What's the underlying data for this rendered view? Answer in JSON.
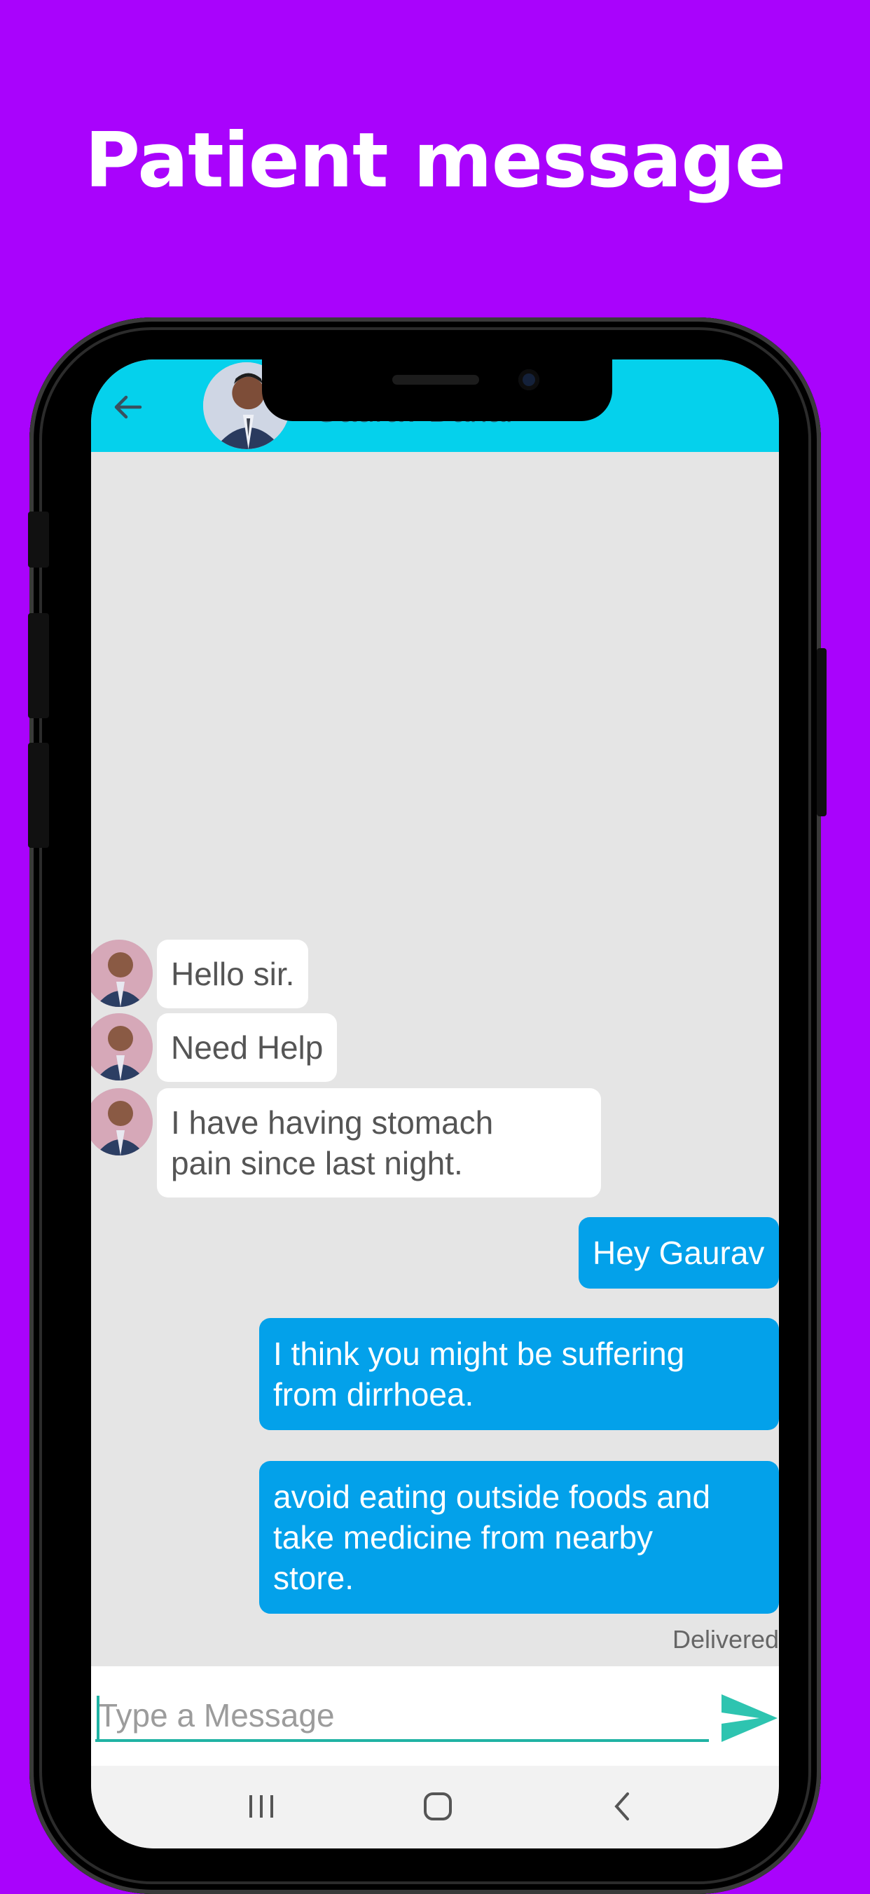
{
  "promo": {
    "title": "Patient message"
  },
  "header": {
    "contact_name": "Gaurav Dahal"
  },
  "messages": [
    {
      "from": "patient",
      "text": "Hello sir."
    },
    {
      "from": "patient",
      "text": "Need Help"
    },
    {
      "from": "patient",
      "text": "I have having stomach\npain since last night."
    },
    {
      "from": "doctor",
      "text": "Hey Gaurav"
    },
    {
      "from": "doctor",
      "text": "I think you might be suffering\nfrom dirrhoea."
    },
    {
      "from": "doctor",
      "text": "avoid eating outside foods and\ntake medicine from nearby\nstore."
    }
  ],
  "status": "Delivered",
  "composer": {
    "placeholder": "Type a Message",
    "value": ""
  },
  "icons": {
    "back": "arrow-left-icon",
    "send": "send-icon",
    "nav_recents": "recents-icon",
    "nav_home": "home-icon",
    "nav_back": "chevron-left-icon"
  },
  "colors": {
    "background": "#a903fc",
    "appbar": "#05d1ec",
    "outgoing_bubble": "#03a1ea",
    "incoming_bubble": "#ffffff",
    "accent": "#20b3a4"
  }
}
